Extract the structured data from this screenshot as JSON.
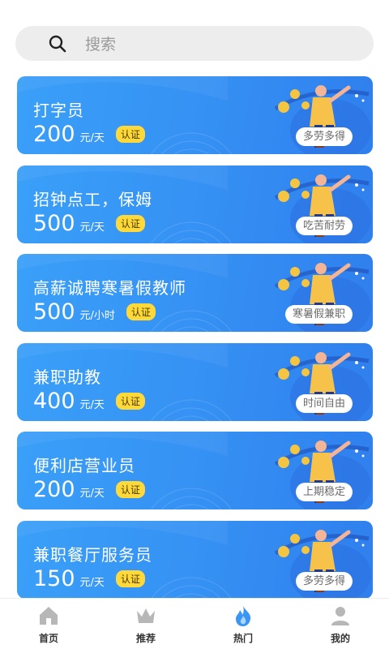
{
  "search": {
    "placeholder": "搜索"
  },
  "jobs": [
    {
      "title": "打字员",
      "amount": "200",
      "unit": "元/天",
      "badge": "认证",
      "tag": "多劳多得"
    },
    {
      "title": "招钟点工，保姆",
      "amount": "500",
      "unit": "元/天",
      "badge": "认证",
      "tag": "吃苦耐劳"
    },
    {
      "title": "高薪诚聘寒暑假教师",
      "amount": "500",
      "unit": "元/小时",
      "badge": "认证",
      "tag": "寒暑假兼职"
    },
    {
      "title": "兼职助教",
      "amount": "400",
      "unit": "元/天",
      "badge": "认证",
      "tag": "时间自由"
    },
    {
      "title": "便利店营业员",
      "amount": "200",
      "unit": "元/天",
      "badge": "认证",
      "tag": "上期稳定"
    },
    {
      "title": "兼职餐厅服务员",
      "amount": "150",
      "unit": "元/天",
      "badge": "认证",
      "tag": "多劳多得"
    }
  ],
  "tabbar": {
    "items": [
      {
        "label": "首页",
        "icon": "home-icon",
        "active": false
      },
      {
        "label": "推荐",
        "icon": "crown-icon",
        "active": false
      },
      {
        "label": "热门",
        "icon": "flame-icon",
        "active": true
      },
      {
        "label": "我的",
        "icon": "user-icon",
        "active": false
      }
    ]
  },
  "colors": {
    "card": "#3590f3",
    "badge": "#ffd93a",
    "active_icon": "#3a96f5",
    "inactive_icon": "#b7b7b7"
  }
}
